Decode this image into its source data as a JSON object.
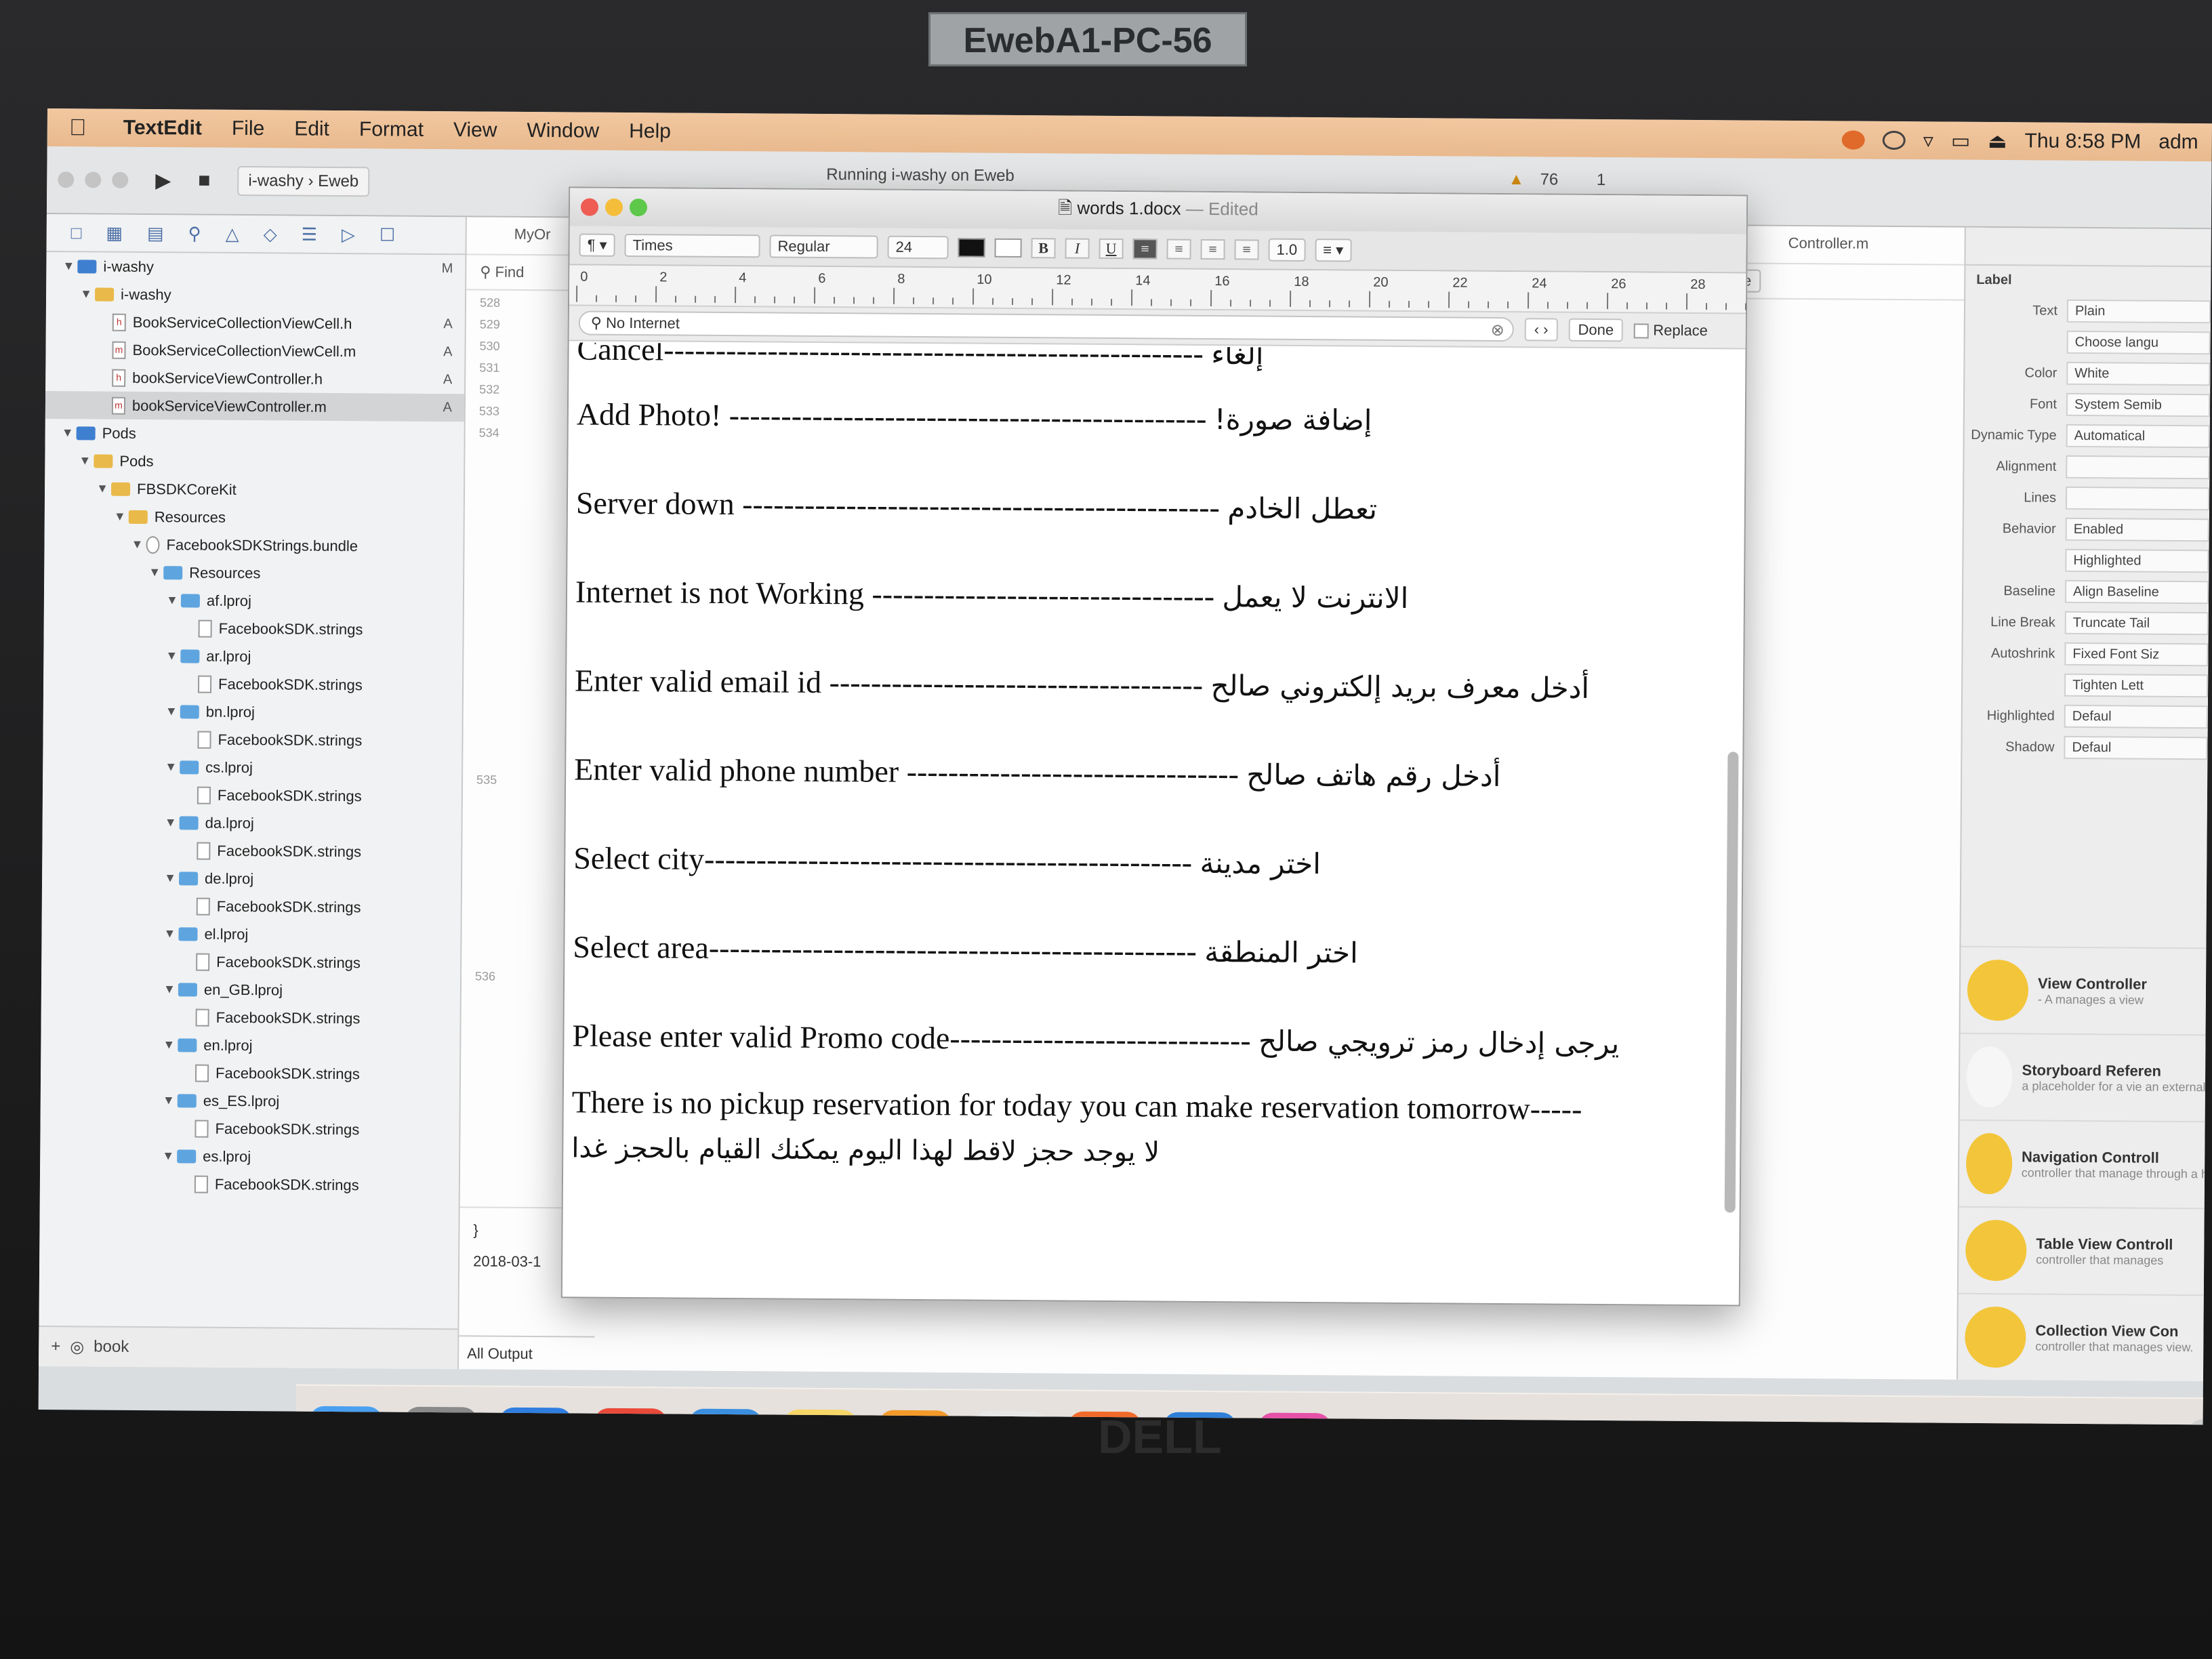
{
  "monitor": {
    "label": "EwebA1-PC-56",
    "brand": "DELL"
  },
  "menubar": {
    "app": "TextEdit",
    "items": [
      "File",
      "Edit",
      "Format",
      "View",
      "Window",
      "Help"
    ],
    "clock": "Thu 8:58 PM",
    "user": "adm"
  },
  "xcode": {
    "scheme": "i-washy",
    "destination": "Eweb",
    "activity": "Running i-washy on Eweb",
    "warnings": "76",
    "errors": "1",
    "tab_left": "MyOr",
    "tab_right": "Controller.m",
    "tree": [
      {
        "label": "i-washy",
        "depth": 0,
        "kind": "project",
        "badge": "M"
      },
      {
        "label": "i-washy",
        "depth": 1,
        "kind": "folder-y"
      },
      {
        "label": "BookServiceCollectionViewCell.h",
        "depth": 2,
        "kind": "file",
        "ext": "h",
        "badge": "A"
      },
      {
        "label": "BookServiceCollectionViewCell.m",
        "depth": 2,
        "kind": "file",
        "ext": "m",
        "badge": "A"
      },
      {
        "label": "bookServiceViewController.h",
        "depth": 2,
        "kind": "file",
        "ext": "h",
        "badge": "A"
      },
      {
        "label": "bookServiceViewController.m",
        "depth": 2,
        "kind": "file",
        "ext": "m",
        "badge": "A",
        "selected": true
      },
      {
        "label": "Pods",
        "depth": 0,
        "kind": "project"
      },
      {
        "label": "Pods",
        "depth": 1,
        "kind": "folder-y"
      },
      {
        "label": "FBSDKCoreKit",
        "depth": 2,
        "kind": "folder-y"
      },
      {
        "label": "Resources",
        "depth": 3,
        "kind": "folder-y"
      },
      {
        "label": "FacebookSDKStrings.bundle",
        "depth": 4,
        "kind": "bundle"
      },
      {
        "label": "Resources",
        "depth": 5,
        "kind": "folder"
      },
      {
        "label": "af.lproj",
        "depth": 6,
        "kind": "folder"
      },
      {
        "label": "FacebookSDK.strings",
        "depth": 7,
        "kind": "file"
      },
      {
        "label": "ar.lproj",
        "depth": 6,
        "kind": "folder"
      },
      {
        "label": "FacebookSDK.strings",
        "depth": 7,
        "kind": "file"
      },
      {
        "label": "bn.lproj",
        "depth": 6,
        "kind": "folder"
      },
      {
        "label": "FacebookSDK.strings",
        "depth": 7,
        "kind": "file"
      },
      {
        "label": "cs.lproj",
        "depth": 6,
        "kind": "folder"
      },
      {
        "label": "FacebookSDK.strings",
        "depth": 7,
        "kind": "file"
      },
      {
        "label": "da.lproj",
        "depth": 6,
        "kind": "folder"
      },
      {
        "label": "FacebookSDK.strings",
        "depth": 7,
        "kind": "file"
      },
      {
        "label": "de.lproj",
        "depth": 6,
        "kind": "folder"
      },
      {
        "label": "FacebookSDK.strings",
        "depth": 7,
        "kind": "file"
      },
      {
        "label": "el.lproj",
        "depth": 6,
        "kind": "folder"
      },
      {
        "label": "FacebookSDK.strings",
        "depth": 7,
        "kind": "file"
      },
      {
        "label": "en_GB.lproj",
        "depth": 6,
        "kind": "folder"
      },
      {
        "label": "FacebookSDK.strings",
        "depth": 7,
        "kind": "file"
      },
      {
        "label": "en.lproj",
        "depth": 6,
        "kind": "folder"
      },
      {
        "label": "FacebookSDK.strings",
        "depth": 7,
        "kind": "file"
      },
      {
        "label": "es_ES.lproj",
        "depth": 6,
        "kind": "folder"
      },
      {
        "label": "FacebookSDK.strings",
        "depth": 7,
        "kind": "file"
      },
      {
        "label": "es.lproj",
        "depth": 6,
        "kind": "folder"
      },
      {
        "label": "FacebookSDK.strings",
        "depth": 7,
        "kind": "file"
      }
    ],
    "filter_text": "book",
    "find_label": "Find",
    "line_numbers": [
      "528",
      "529",
      "530",
      "531",
      "532",
      "533",
      "534"
    ],
    "line_numbers_lower": [
      "535",
      "536"
    ],
    "console_date": "2018-03-1",
    "all_output": "All Output",
    "done": "Done"
  },
  "inspector": {
    "section": "Label",
    "rows": [
      {
        "key": "Text",
        "value": "Plain"
      },
      {
        "key": "",
        "value": "Choose langu"
      },
      {
        "key": "Color",
        "value": "White"
      },
      {
        "key": "Font",
        "value": "System Semib"
      },
      {
        "key": "Dynamic Type",
        "value": "Automatical"
      },
      {
        "key": "Alignment",
        "value": ""
      },
      {
        "key": "Lines",
        "value": ""
      },
      {
        "key": "Behavior",
        "value": "Enabled"
      },
      {
        "key": "",
        "value": "Highlighted"
      },
      {
        "key": "Baseline",
        "value": "Align Baseline"
      },
      {
        "key": "Line Break",
        "value": "Truncate Tail"
      },
      {
        "key": "Autoshrink",
        "value": "Fixed Font Siz"
      },
      {
        "key": "",
        "value": "Tighten Lett"
      },
      {
        "key": "Highlighted",
        "value": "Defaul"
      },
      {
        "key": "Shadow",
        "value": "Defaul"
      }
    ],
    "library": [
      {
        "title": "View Controller",
        "sub": "- A manages a view",
        "icon": "view-controller-icon",
        "color": "#f3c53a"
      },
      {
        "title": "Storyboard Referen",
        "sub": "a placeholder for a vie an external storyboard",
        "icon": "storyboard-reference-icon",
        "color": "#f6f6f6"
      },
      {
        "title": "Navigation Controll",
        "sub": "controller that manage through a hierarchy of",
        "icon": "navigation-controller-icon",
        "color": "#f3c53a"
      },
      {
        "title": "Table View Controll",
        "sub": "controller that manages",
        "icon": "table-view-controller-icon",
        "color": "#f3c53a"
      },
      {
        "title": "Collection View Con",
        "sub": "controller that manages view.",
        "icon": "collection-view-controller-icon",
        "color": "#f3c53a"
      }
    ]
  },
  "textedit": {
    "filename": "words 1.docx",
    "edited": "— Edited",
    "font": "Times",
    "style": "Regular",
    "size": "24",
    "spacing": "1.0",
    "ruler": [
      "0",
      "2",
      "4",
      "6",
      "8",
      "10",
      "12",
      "14",
      "16",
      "18",
      "20",
      "22",
      "24",
      "26",
      "28"
    ],
    "find_text": "No Internet",
    "done": "Done",
    "replace": "Replace",
    "lines": [
      {
        "en": "Cancel----------------------------------------------------",
        "ar": "إلغاء",
        "cut": true
      },
      {
        "en": "Add Photo! ----------------------------------------------",
        "ar": "إضافة صورة!"
      },
      {
        "en": "Server down ----------------------------------------------",
        "ar": "تعطل الخادم"
      },
      {
        "en": "Internet is not Working ---------------------------------",
        "ar": "الانترنت لا يعمل"
      },
      {
        "en": "Enter valid email id ------------------------------------",
        "ar": "أدخل معرف بريد إلكتروني صالح"
      },
      {
        "en": "Enter valid phone number --------------------------------",
        "ar": "أدخل رقم هاتف صالح"
      },
      {
        "en": "Select city-----------------------------------------------",
        "ar": "اختر مدينة"
      },
      {
        "en": "Select area-----------------------------------------------",
        "ar": "اختر المنطقة"
      },
      {
        "en": "Please enter valid Promo code-----------------------------",
        "ar": "يرجى إدخال رمز ترويجي صالح"
      }
    ],
    "last_en": "There is no pickup reservation for today you can make reservation tomorrow-----",
    "last_ar": "لا يوجد حجز لاقط لهذا اليوم يمكنك القيام بالحجز غدا"
  },
  "dock": {
    "apps": [
      {
        "name": "finder-icon",
        "color": "#4aa0f0"
      },
      {
        "name": "system-preferences-icon",
        "color": "#8a8a8a"
      },
      {
        "name": "safari-icon",
        "color": "#2f7ee0"
      },
      {
        "name": "chrome-icon",
        "color": "#e94a3a"
      },
      {
        "name": "xcode-simulator-icon",
        "color": "#3b8fe0"
      },
      {
        "name": "notes-icon",
        "color": "#f6d667"
      },
      {
        "name": "hotspot-shield-icon",
        "color": "#f39a2a"
      },
      {
        "name": "textedit-icon",
        "color": "#e6e6e6"
      },
      {
        "name": "instruments-icon",
        "color": "#f26a2a"
      },
      {
        "name": "xcode-icon",
        "color": "#2e7fd8"
      },
      {
        "name": "itunes-icon",
        "color": "#e651a8"
      }
    ],
    "windows": 8,
    "trash": "trash-icon"
  }
}
